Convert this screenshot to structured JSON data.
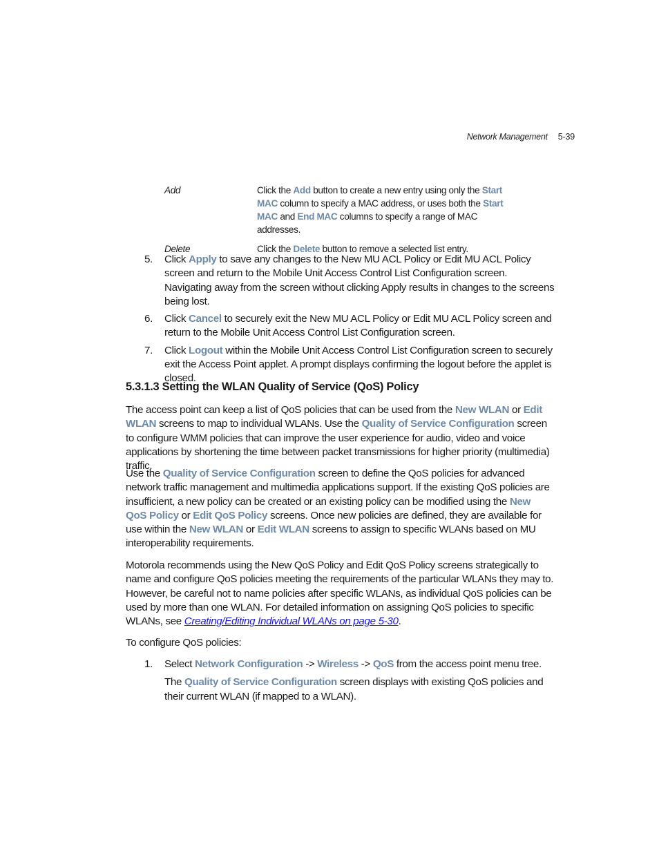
{
  "header": {
    "section": "Network Management",
    "page": "5-39"
  },
  "definitions": [
    {
      "term": "Add",
      "parts": {
        "t1": "Click the ",
        "b1": "Add",
        "t2": " button to create a new entry using only the ",
        "b2": "Start MAC",
        "t3": " column to specify a MAC address, or uses both the ",
        "b3": "Start MAC",
        "t4": " and ",
        "b4": "End MAC",
        "t5": " columns to specify a range of MAC addresses."
      }
    },
    {
      "term": "Delete",
      "parts": {
        "t1": "Click the ",
        "b1": "Delete",
        "t2": " button to remove a selected list entry."
      }
    }
  ],
  "steps_a": [
    {
      "num": "5.",
      "t1": "Click ",
      "b1": "Apply",
      "t2": " to save any changes to the New MU ACL Policy or Edit MU ACL Policy screen and return to the Mobile Unit Access Control List Configuration screen. Navigating away from the screen without clicking Apply results in changes to the screens being lost."
    },
    {
      "num": "6.",
      "t1": "Click ",
      "b1": "Cancel",
      "t2": " to securely exit the New MU ACL Policy or Edit MU ACL Policy screen and return to the Mobile Unit Access Control List Configuration screen."
    },
    {
      "num": "7.",
      "t1": "Click ",
      "b1": "Logout",
      "t2": " within the Mobile Unit Access Control List Configuration screen to securely exit the Access Point applet. A prompt displays confirming the logout before the applet is closed."
    }
  ],
  "section_heading": "5.3.1.3  Setting the WLAN Quality of Service (QoS) Policy",
  "para1": {
    "t1": "The access point can keep a list of QoS policies that can be used from the ",
    "b1": "New WLAN",
    "t2": " or ",
    "b2": "Edit WLAN",
    "t3": " screens to map to individual WLANs. Use the ",
    "b3": "Quality of Service Configuration",
    "t4": " screen to configure WMM policies that can improve the user experience for audio, video and voice applications by shortening the time between packet transmissions for higher priority (multimedia) traffic."
  },
  "para2": {
    "t1": "Use the ",
    "b1": "Quality of Service Configuration",
    "t2": " screen to define the QoS policies for advanced network traffic management and multimedia applications support. If the existing QoS policies are insufficient, a new policy can be created or an existing policy can be modified using the ",
    "b2": "New QoS Policy",
    "t3": " or ",
    "b3": "Edit QoS Policy",
    "t4": " screens. Once new policies are defined, they are available for use within the ",
    "b4": "New WLAN",
    "t5": " or ",
    "b5": "Edit WLAN",
    "t6": " screens to assign to specific WLANs based on MU interoperability requirements."
  },
  "para3": {
    "t1": "Motorola recommends using the New QoS Policy and Edit QoS Policy screens strategically to name and configure QoS policies meeting the requirements of the particular WLANs they may to. However, be careful not to name policies after specific WLANs, as individual QoS policies can be used by more than one WLAN. For detailed information on assigning QoS policies to specific WLANs, see ",
    "link": "Creating/Editing Individual WLANs on page 5-30",
    "t2": "."
  },
  "para4": "To configure QoS policies:",
  "steps_b": [
    {
      "num": "1.",
      "t1": "Select ",
      "b1": "Network Configuration",
      "t2": " -> ",
      "b2": "Wireless",
      "t3": " -> ",
      "b3": "QoS",
      "t4": " from the access point menu tree.",
      "sub": {
        "t1": "The ",
        "b1": "Quality of Service Configuration",
        "t2": " screen displays with existing QoS policies and their current WLAN (if mapped to a WLAN)."
      }
    }
  ],
  "colors": {
    "ui_term": "#6d8aa8",
    "link": "#1a1adc",
    "text": "#1a1a1a"
  }
}
